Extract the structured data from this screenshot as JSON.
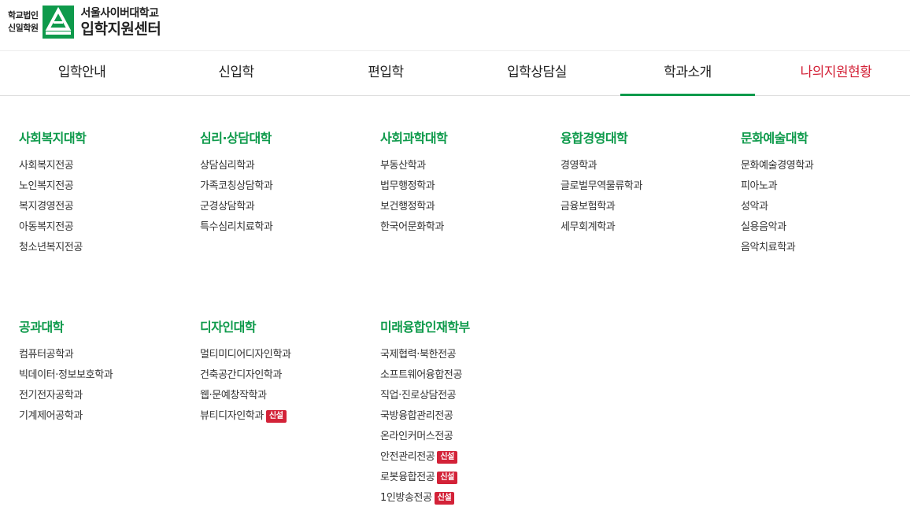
{
  "logo": {
    "corp_line1": "학교법인",
    "corp_line2": "신일학원",
    "title_line1": "서울사이버대학교",
    "title_line2": "입학지원센터",
    "mark_icon": "university-emblem-icon",
    "brand_color": "#0e9a4b"
  },
  "nav": {
    "items": [
      {
        "label": "입학안내"
      },
      {
        "label": "신입학"
      },
      {
        "label": "편입학"
      },
      {
        "label": "입학상담실"
      },
      {
        "label": "학과소개"
      },
      {
        "label": "나의지원현황"
      }
    ],
    "active": "학과소개",
    "accent_color": "#d32238"
  },
  "badge_label": "신설",
  "colleges": [
    {
      "name": "사회복지대학",
      "depts": [
        "사회복지전공",
        "노인복지전공",
        "복지경영전공",
        "아동복지전공",
        "청소년복지전공"
      ]
    },
    {
      "name": "심리·상담대학",
      "depts": [
        "상담심리학과",
        "가족코칭상담학과",
        "군경상담학과",
        "특수심리치료학과"
      ]
    },
    {
      "name": "사회과학대학",
      "depts": [
        "부동산학과",
        "법무행정학과",
        "보건행정학과",
        "한국어문화학과"
      ]
    },
    {
      "name": "융합경영대학",
      "depts": [
        "경영학과",
        "글로벌무역물류학과",
        "금융보험학과",
        "세무회계학과"
      ]
    },
    {
      "name": "문화예술대학",
      "depts": [
        "문화예술경영학과",
        "피아노과",
        "성악과",
        "실용음악과",
        "음악치료학과"
      ]
    },
    {
      "name": "공과대학",
      "depts": [
        "컴퓨터공학과",
        "빅데이터·정보보호학과",
        "전기전자공학과",
        "기계제어공학과"
      ]
    },
    {
      "name": "디자인대학",
      "depts": [
        "멀티미디어디자인학과",
        "건축공간디자인학과",
        "웹·문예창작학과",
        "뷰티디자인학과"
      ],
      "new": [
        3
      ]
    },
    {
      "name": "미래융합인재학부",
      "depts": [
        "국제협력·북한전공",
        "소프트웨어융합전공",
        "직업·진로상담전공",
        "국방융합관리전공",
        "온라인커머스전공",
        "안전관리전공",
        "로봇융합전공",
        "1인방송전공"
      ],
      "new": [
        5,
        6,
        7
      ]
    }
  ]
}
